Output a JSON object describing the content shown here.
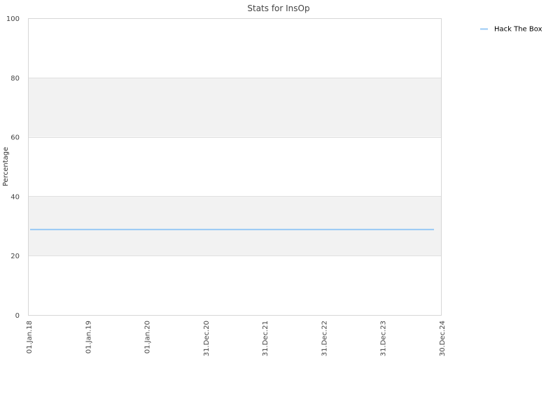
{
  "chart_data": {
    "type": "line",
    "title": "Stats for InsOp",
    "xlabel": "",
    "ylabel": "Percentage",
    "ylim": [
      0,
      100
    ],
    "yticks": [
      0,
      20,
      40,
      60,
      80,
      100
    ],
    "x_ticks": [
      "01.Jan.18",
      "01.Jan.19",
      "01.Jan.20",
      "31.Dec.20",
      "31.Dec.21",
      "31.Dec.22",
      "31.Dec.23",
      "30.Dec.24"
    ],
    "grid": true,
    "alternating_bands": true,
    "legend_position": "top-right",
    "series": [
      {
        "name": "Hack The Box",
        "color": "#99c9f5",
        "x": [
          "01.Jan.18",
          "30.Dec.24"
        ],
        "values": [
          28.8,
          28.8
        ]
      }
    ]
  },
  "colors": {
    "band": "#f2f2f2",
    "grid": "#e0e0e0",
    "axis": "#d6d6d6"
  }
}
